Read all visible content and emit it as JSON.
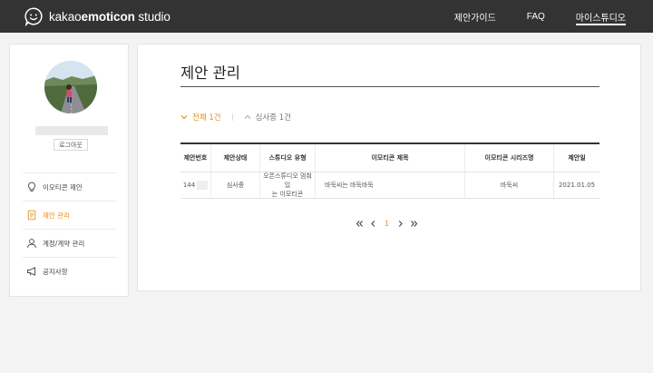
{
  "header": {
    "brand_light": "kakao",
    "brand_bold": "emoticon",
    "brand_suffix": " studio",
    "nav": [
      {
        "label": "제안가이드",
        "active": false
      },
      {
        "label": "FAQ",
        "active": false
      },
      {
        "label": "마이스튜디오",
        "active": true
      }
    ]
  },
  "sidebar": {
    "logout_label": "로그아웃",
    "items": [
      {
        "label": "이모티콘 제안",
        "icon": "lightbulb-icon",
        "active": false
      },
      {
        "label": "제안 관리",
        "icon": "document-icon",
        "active": true
      },
      {
        "label": "계정/계약 관리",
        "icon": "user-icon",
        "active": false
      },
      {
        "label": "공지사항",
        "icon": "megaphone-icon",
        "active": false
      }
    ]
  },
  "main": {
    "title": "제안 관리",
    "filters": {
      "all": "전체 1건",
      "reviewing": "심사중 1건"
    },
    "table": {
      "headers": [
        "제안번호",
        "제안상태",
        "스튜디오 유형",
        "이모티콘 제목",
        "이모티콘 시리즈명",
        "제안일"
      ],
      "rows": [
        {
          "id": "144",
          "status": "심사중",
          "type_line1": "오픈스튜디오 멈춰있",
          "type_line2": "는 이모티콘",
          "title": "바둑씨는 바둑바둑",
          "series": "바둑씨",
          "date": "2021.01.05"
        }
      ]
    },
    "pager": {
      "current": "1"
    }
  },
  "colors": {
    "header_bg": "#333333",
    "accent": "#e28d1b",
    "page_bg": "#f3f3f3"
  }
}
